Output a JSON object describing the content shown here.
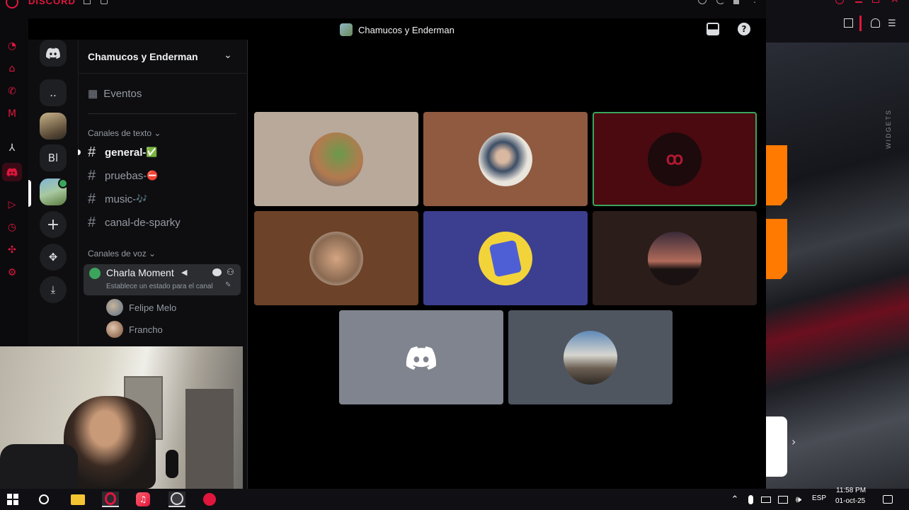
{
  "opera": {
    "brand": "DISCORD"
  },
  "header": {
    "call_title": "Chamucos y Enderman"
  },
  "server": {
    "name": "Chamucos y Enderman",
    "dots_label": "..",
    "bl_label": "Bl"
  },
  "channels": {
    "events_label": "Eventos",
    "text_category": "Canales de texto",
    "text_channels": [
      {
        "name": "general-",
        "emoji": "✅"
      },
      {
        "name": "pruebas-",
        "emoji": "⛔"
      },
      {
        "name": "music-",
        "emoji": "🎶"
      },
      {
        "name": "canal-de-sparky",
        "emoji": ""
      }
    ],
    "voice_category": "Canales de voz",
    "voice_channel": {
      "name": "Charla Moment",
      "status_placeholder": "Establece un estado para el canal"
    },
    "voice_members": [
      "Felipe Melo",
      "Francho"
    ]
  },
  "taskbar": {
    "lang": "ESP",
    "time": "11:58 PM",
    "date": "01-oct-25"
  },
  "colors": {
    "opera_red": "#e0163c",
    "speaking_green": "#3ba55c",
    "discord_blurple": "#5865f2"
  },
  "right_panel": {
    "widgets_label": "WIDGETS"
  }
}
